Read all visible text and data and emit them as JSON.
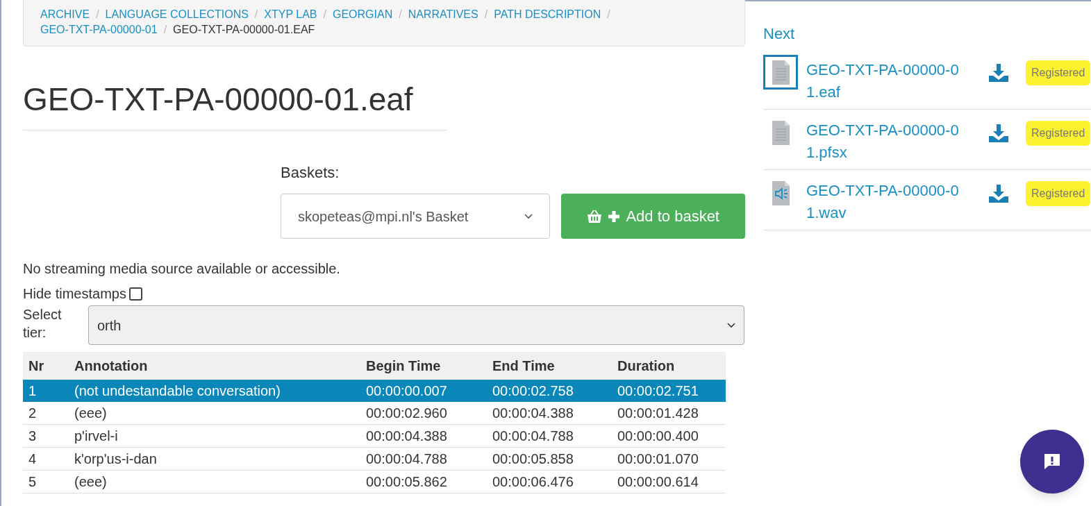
{
  "breadcrumbs": [
    {
      "label": "ARCHIVE",
      "link": true
    },
    {
      "separator": "/",
      "label": "LANGUAGE COLLECTIONS",
      "link": true
    },
    {
      "separator": "/",
      "label": "XTYP LAB",
      "link": true
    },
    {
      "separator": "/",
      "label": "GEORGIAN",
      "link": true
    },
    {
      "separator": "/",
      "label": "NARRATIVES",
      "link": true
    },
    {
      "separator": "/",
      "label": "PATH DESCRIPTION",
      "link": true
    },
    {
      "separator": "/",
      "label": "GEO-TXT-PA-00000-01",
      "link": true
    },
    {
      "separator": "/",
      "label": "GEO-TXT-PA-00000-01.EAF",
      "link": false
    }
  ],
  "title": "GEO-TXT-PA-00000-01.eaf",
  "baskets": {
    "label": "Baskets:",
    "value": "skopeteas@mpi.nl's Basket",
    "button": "Add to basket"
  },
  "media_notice": "No streaming media source available or accessible.",
  "hide_timestamps": {
    "label": "Hide timestamps",
    "checked": false
  },
  "tier": {
    "label": "Select tier:",
    "value": "orth"
  },
  "table": {
    "columns": [
      "Nr",
      "Annotation",
      "Begin Time",
      "End Time",
      "Duration"
    ],
    "rows": [
      {
        "cells": [
          "1",
          "(not undestandable conversation)",
          "00:00:00.007",
          "00:00:02.758",
          "00:00:02.751"
        ],
        "selected": true
      },
      {
        "cells": [
          "2",
          "(eee)",
          "00:00:02.960",
          "00:00:04.388",
          "00:00:01.428"
        ],
        "selected": false
      },
      {
        "cells": [
          "3",
          "p'irvel-i",
          "00:00:04.388",
          "00:00:04.788",
          "00:00:00.400"
        ],
        "selected": false
      },
      {
        "cells": [
          "4",
          "k'orp'us-i-dan",
          "00:00:04.788",
          "00:00:05.858",
          "00:00:01.070"
        ],
        "selected": false
      },
      {
        "cells": [
          "5",
          "(eee)",
          "00:00:05.862",
          "00:00:06.476",
          "00:00:00.614"
        ],
        "selected": false
      }
    ]
  },
  "sidebar": {
    "next_label": "Next",
    "files": [
      {
        "kind": "document",
        "name": "GEO-TXT-PA-00000-0",
        "name_rest": "1.eaf",
        "badge": "Registered",
        "selected": true
      },
      {
        "kind": "document",
        "name": "GEO-TXT-PA-00000-0",
        "name_rest": "1.pfsx",
        "badge": "Registered",
        "selected": false
      },
      {
        "kind": "audio",
        "name": "GEO-TXT-PA-00000-0",
        "name_rest": "1.wav",
        "badge": "Registered",
        "selected": false
      }
    ]
  }
}
